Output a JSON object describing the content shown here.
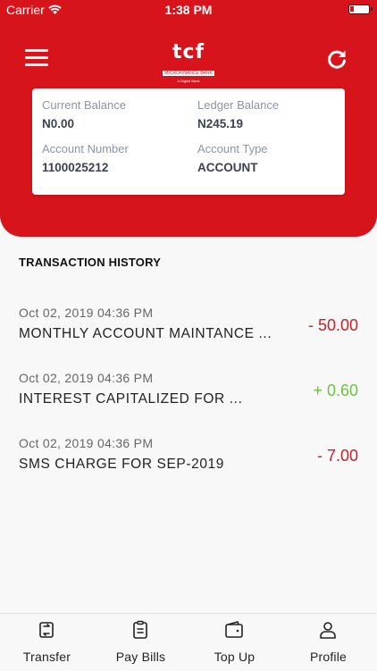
{
  "status_bar": {
    "carrier": "Carrier",
    "time": "1:38 PM"
  },
  "header": {
    "logo": {
      "mark": "tcf",
      "subtitle": "MICROFINANCE BANK",
      "tagline": "A Digital Bank"
    },
    "icons": {
      "menu": "hamburger-menu-icon",
      "refresh": "refresh-icon"
    }
  },
  "account": {
    "current_balance_label": "Current Balance",
    "current_balance": "N0.00",
    "ledger_balance_label": "Ledger Balance",
    "ledger_balance": "N245.19",
    "account_number_label": "Account Number",
    "account_number": "1100025212",
    "account_type_label": "Account Type",
    "account_type": "ACCOUNT"
  },
  "transactions": {
    "title": "TRANSACTION HISTORY",
    "items": [
      {
        "date": "Oct 02, 2019 04:36 PM",
        "description": "MONTHLY ACCOUNT MAINTANCE ...",
        "amount": "- 50.00",
        "type": "debit"
      },
      {
        "date": "Oct 02, 2019 04:36 PM",
        "description": "INTEREST CAPITALIZED FOR ...",
        "amount": "+ 0.60",
        "type": "credit"
      },
      {
        "date": "Oct 02, 2019 04:36 PM",
        "description": "SMS CHARGE FOR SEP-2019",
        "amount": "- 7.00",
        "type": "debit"
      }
    ]
  },
  "tabbar": {
    "tabs": [
      {
        "label": "Transfer",
        "icon": "transfer-icon"
      },
      {
        "label": "Pay Bills",
        "icon": "clipboard-icon"
      },
      {
        "label": "Top Up",
        "icon": "wallet-icon"
      },
      {
        "label": "Profile",
        "icon": "user-icon"
      }
    ]
  },
  "colors": {
    "brand_red": "#d7141c",
    "debit": "#c8202a",
    "credit": "#6cc33c"
  }
}
